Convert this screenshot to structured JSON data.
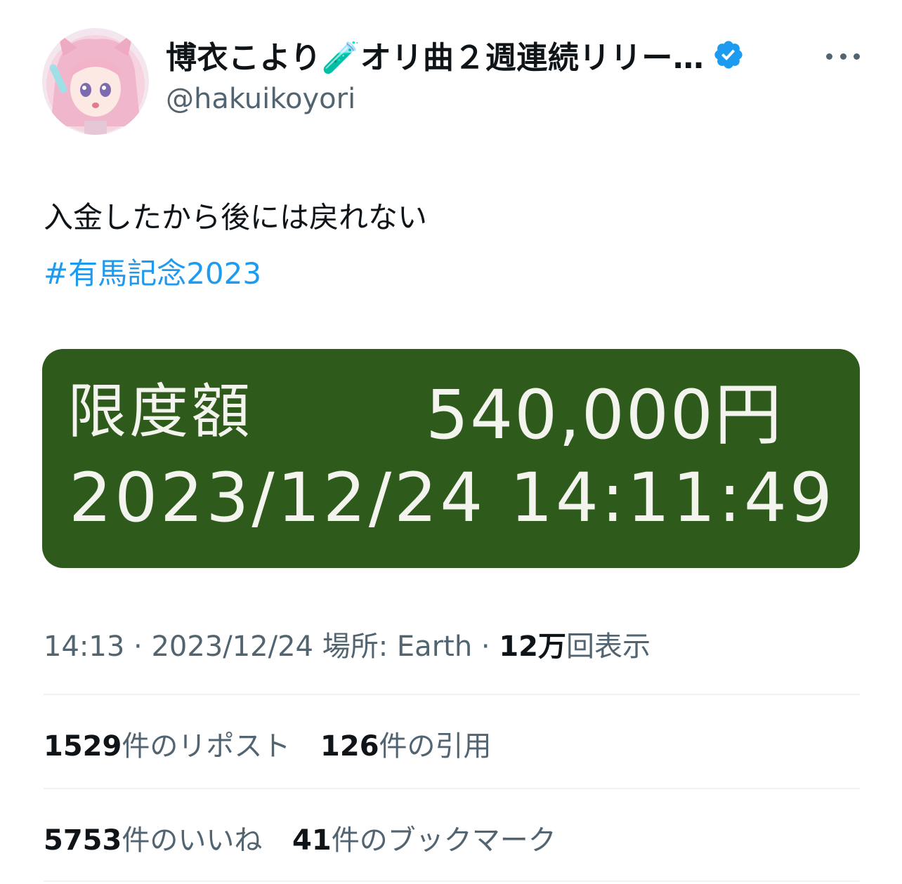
{
  "author": {
    "display_name": "博衣こより🧪オリ曲２週連続リリー…",
    "handle": "@hakuikoyori",
    "verified_icon": "verified-badge-icon",
    "verified_color": "#1d9bf0"
  },
  "tweet": {
    "text": "入金したから後には戻れない",
    "hashtag": "#有馬記念2023"
  },
  "media": {
    "label": "限度額",
    "amount": "540,000円",
    "timestamp": "2023/12/24 14:11:49",
    "background": "#2e5a1c"
  },
  "meta": {
    "time": "14:13",
    "separator": " · ",
    "date": "2023/12/24",
    "location_label": "場所: ",
    "location": "Earth",
    "views_count": "12万",
    "views_label": "回表示"
  },
  "stats": {
    "reposts_count": "1529",
    "reposts_label": "件のリポスト",
    "quotes_count": "126",
    "quotes_label": "件の引用",
    "likes_count": "5753",
    "likes_label": "件のいいね",
    "bookmarks_count": "41",
    "bookmarks_label": "件のブックマーク"
  },
  "colors": {
    "text_primary": "#0f1419",
    "text_secondary": "#536471",
    "link": "#1d9bf0",
    "divider": "#eff3f4"
  }
}
